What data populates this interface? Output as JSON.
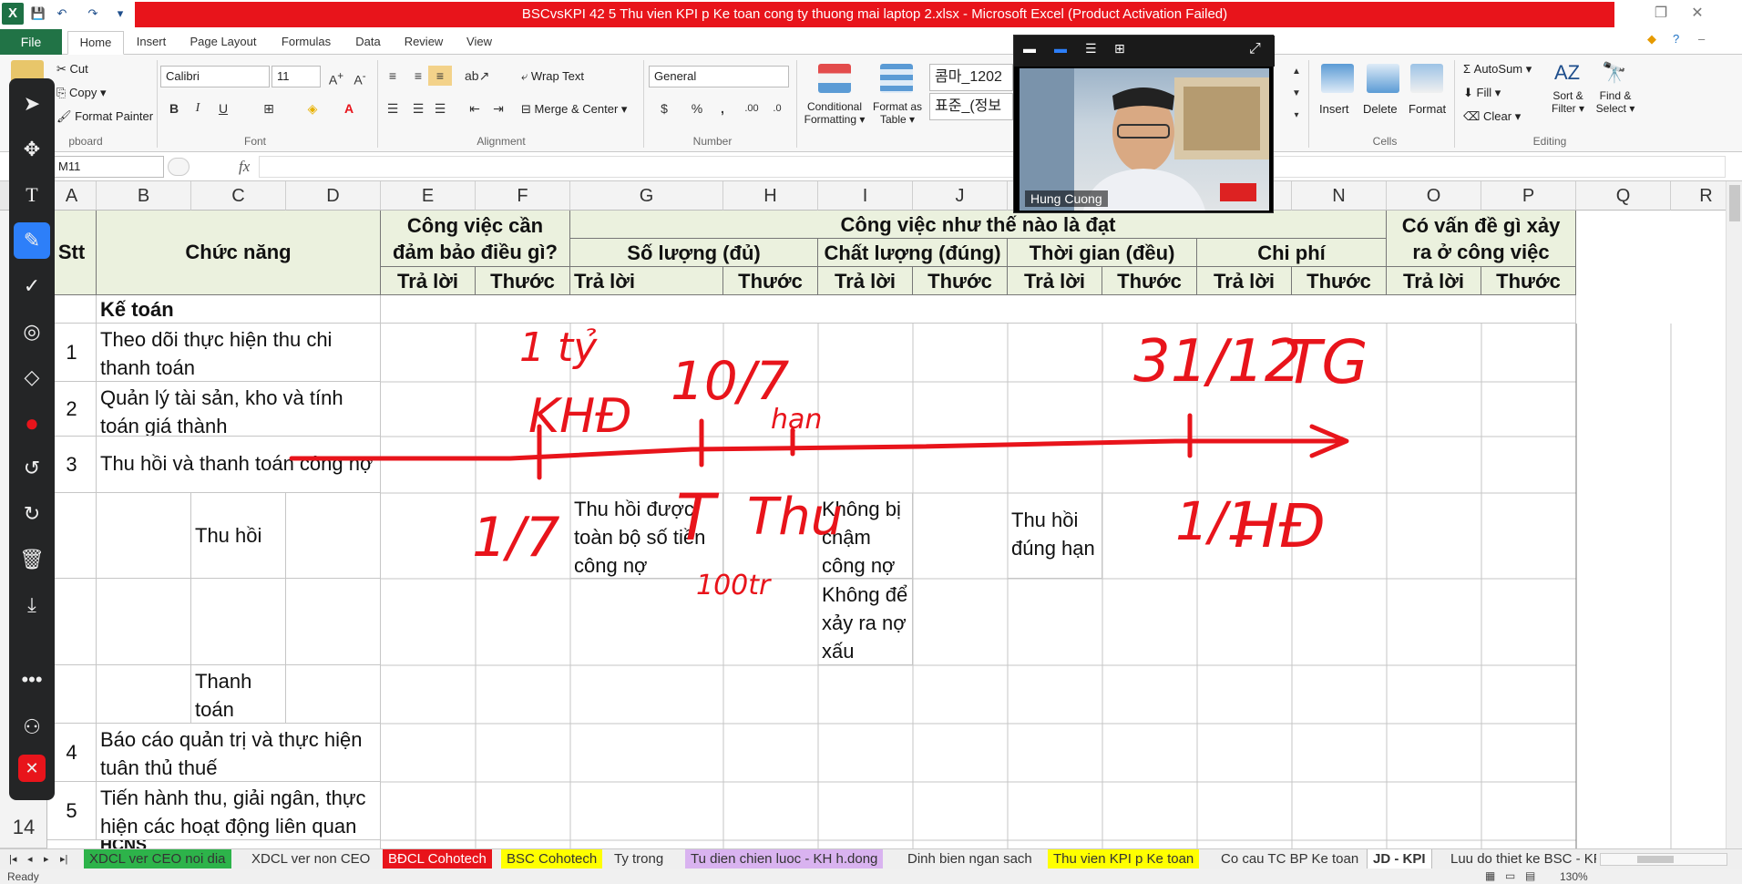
{
  "window": {
    "title": "BSCvsKPI 42 5 Thu vien KPI p Ke toan cong ty thuong mai laptop 2.xlsx -  Microsoft Excel (Product Activation Failed)"
  },
  "ribbon_tabs": {
    "file": "File",
    "tabs": [
      "Home",
      "Insert",
      "Page Layout",
      "Formulas",
      "Data",
      "Review",
      "View"
    ]
  },
  "ribbon": {
    "clipboard": {
      "cut": "Cut",
      "copy": "Copy",
      "format_painter": "Format Painter",
      "label": "pboard"
    },
    "font": {
      "name": "Calibri",
      "size": "11",
      "label": "Font",
      "bold": "B",
      "italic": "I",
      "underline": "U"
    },
    "alignment": {
      "wrap_text": "Wrap Text",
      "merge_center": "Merge & Center",
      "label": "Alignment"
    },
    "number": {
      "format": "General",
      "currency": "$",
      "percent": "%",
      "comma": ",",
      "label": "Number"
    },
    "styles": {
      "conditional": "Conditional",
      "formatting": "Formatting",
      "format_as": "Format as",
      "table": "Table",
      "style1": "콤마_1202",
      "style2": "표준_(정보"
    },
    "cells": {
      "insert": "Insert",
      "delete": "Delete",
      "format": "Format",
      "label": "Cells"
    },
    "editing": {
      "autosum": "AutoSum",
      "fill": "Fill",
      "clear": "Clear",
      "sort_filter": "Sort &",
      "filter": "Filter",
      "find_select": "Find &",
      "select": "Select",
      "label": "Editing"
    }
  },
  "formula_bar": {
    "name_box": "M11",
    "fx": "fx",
    "formula": ""
  },
  "columns": [
    "A",
    "B",
    "C",
    "D",
    "E",
    "F",
    "G",
    "H",
    "I",
    "J",
    "K",
    "L",
    "M",
    "N",
    "O",
    "P",
    "Q",
    "R"
  ],
  "row_numbers": [
    "14"
  ],
  "table_headers": {
    "stt": "Stt",
    "chuc_nang": "Chức năng",
    "cong_viec_can": "Công việc cần đảm bảo điều gì?",
    "cong_viec_nhu": "Công việc như thế nào là đạt",
    "so_luong": "Số lượng (đủ)",
    "chat_luong": "Chất lượng (đúng)",
    "thoi_gian": "Thời gian (đều)",
    "chi_phi": "Chi phí",
    "co_van_de": "Có vấn đề gì xảy ra ở công việc",
    "tra_loi": "Trả lời",
    "thuoc_do": "Thước đo"
  },
  "rows": {
    "ke_toan": "Kế toán",
    "r1_num": "1",
    "r1_text": "Theo dõi thực hiện thu chi thanh toán",
    "r2_num": "2",
    "r2_text": "Quản lý tài sản, kho và tính toán giá thành",
    "r3_num": "3",
    "r3_text": "Thu hồi và thanh toán công nợ",
    "thu_hoi": "Thu hồi",
    "thu_hoi_g": "Thu hồi được toàn bộ số tiền công nợ",
    "thu_hoi_i1": "Không bị chậm công nợ",
    "thu_hoi_i2": "Không để xảy ra nợ xấu",
    "thu_hoi_k": "Thu hồi đúng hạn",
    "thanh_toan": "Thanh toán",
    "r4_num": "4",
    "r4_text": "Báo cáo quản trị và thực hiện tuân thủ thuế",
    "r5_num": "5",
    "r5_text": "Tiến hành thu, giải ngân, thực hiện các hoạt động liên quan",
    "r6_partial": "HCNS"
  },
  "sheet_tabs": [
    {
      "label": "XDCL ver CEO noi dia",
      "color": "#2db34a"
    },
    {
      "label": "XDCL ver non CEO",
      "color": ""
    },
    {
      "label": "BĐCL Cohotech",
      "color": "#e8141b"
    },
    {
      "label": "BSC Cohotech",
      "color": "#ffff00"
    },
    {
      "label": "Ty trong",
      "color": ""
    },
    {
      "label": "Tu dien chien luoc - KH h.dong",
      "color": "#d9b3f0"
    },
    {
      "label": "Dinh bien ngan sach",
      "color": ""
    },
    {
      "label": "Thu vien KPI p Ke toan",
      "color": "#ffff00"
    },
    {
      "label": "Co cau TC BP Ke toan",
      "color": ""
    },
    {
      "label": "JD - KPI",
      "color": "#ffffff"
    },
    {
      "label": "Luu do thiet ke BSC - KPI",
      "color": ""
    }
  ],
  "status": {
    "ready": "Ready",
    "zoom": "130%"
  },
  "video": {
    "participant": "Hung Cuong"
  },
  "annotation_tools": [
    "arrow-icon",
    "move-icon",
    "text-icon",
    "pen-icon",
    "check-icon",
    "spotlight-icon",
    "eraser-icon",
    "color-icon",
    "undo-icon",
    "redo-icon",
    "trash-icon",
    "save-icon",
    "more-icon",
    "person-icon",
    "close-icon"
  ],
  "ink": {
    "color": "#e8141b",
    "labels": [
      "1 tỷ",
      "KHĐ",
      "10/7",
      "hạn",
      "31/12",
      "TG",
      "1/7",
      "T",
      "Thu",
      "100tr",
      "1/1",
      "HĐ"
    ]
  }
}
